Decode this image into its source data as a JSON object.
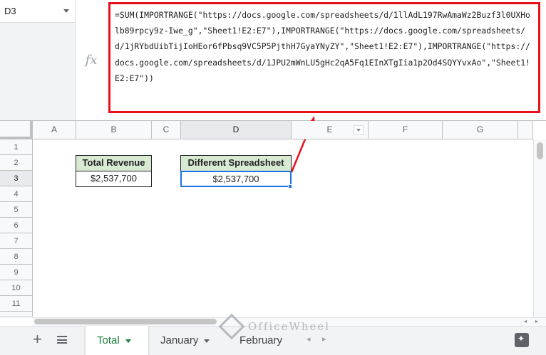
{
  "name_box": {
    "value": "D3"
  },
  "formula_bar": {
    "formula": "=SUM(IMPORTRANGE(\"https://docs.google.com/spreadsheets/d/1llAdL197RwAmaWz2Buzf3l0UXHolb89rpcy9z-Iwe_g\",\"Sheet1!E2:E7\"),IMPORTRANGE(\"https://docs.google.com/spreadsheets/d/1jRYbdUibTijIoHEor6fPbsq9VC5P5PjthH7GyaYNyZY\",\"Sheet1!E2:E7\"),IMPORTRANGE(\"https://docs.google.com/spreadsheets/d/1JPU2mWnLU5gHc2qA5Fq1EInXTgIia1p2Od4SQYYvxAo\",\"Sheet1!E2:E7\"))"
  },
  "columns": [
    "A",
    "B",
    "C",
    "D",
    "E",
    "F",
    "G"
  ],
  "rows": [
    "1",
    "2",
    "3",
    "4",
    "5",
    "6",
    "7",
    "8",
    "9",
    "10",
    "11"
  ],
  "selected": {
    "column": "D",
    "row": "3"
  },
  "cells": {
    "b2": "Total Revenue",
    "b3": "$2,537,700",
    "d2": "Different Spreadsheet",
    "d3": "$2,537,700"
  },
  "sheet_tabs": [
    {
      "label": "Total",
      "active": true
    },
    {
      "label": "January",
      "active": false
    },
    {
      "label": "February",
      "active": false
    }
  ],
  "watermark": {
    "text": "OfficeWheel"
  },
  "colors": {
    "highlight_border": "#e8111b",
    "header_fill": "#d9ead3",
    "selection": "#1a73e8",
    "active_tab": "#188038"
  },
  "icons": {
    "fx": "fx",
    "add_sheet": "+"
  }
}
